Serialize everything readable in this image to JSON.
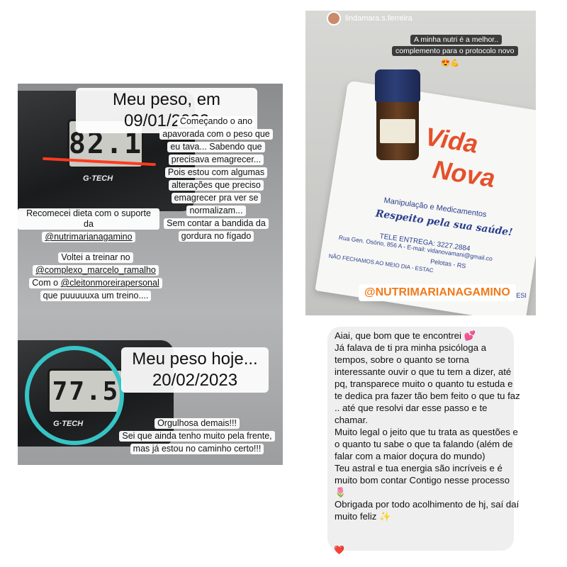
{
  "left_story": {
    "date_title": "Meu peso, em 09/01/2023",
    "scale1_reading": "82.1",
    "scale_brand": "G·TECH",
    "intro_lines": [
      "Começando o ano",
      "apavorada com o peso que",
      "eu tava... Sabendo que",
      "precisava emagrecer...",
      "Pois estou com algumas",
      "alterações que preciso",
      "emagrecer pra ver se",
      "normalizam...",
      "Sem contar a bandida da",
      "gordura no fígado"
    ],
    "diet_line": "Recomecei dieta com o suporte da",
    "diet_mention": "@nutrimarianagamino",
    "train_line1": "Voltei a treinar no",
    "train_mention1": "@complexo_marcelo_ramalho",
    "train_prefix2": "Com o",
    "train_mention2": "@cleitonmoreirapersonal",
    "train_line3": "que puuuuuxa um treino....",
    "today_title_1": "Meu peso hoje...",
    "today_title_2": "20/02/2023",
    "scale2_reading": "77.5",
    "proud_lines": [
      "Orgulhosa demais!!!",
      "Sei que ainda tenho muito pela frente,",
      "mas já estou no caminho certo!!!"
    ]
  },
  "top_right_story": {
    "username": "lindamara.s.ferreira",
    "caption_1": "A minha nutri é a melhor..",
    "caption_2": "complemento para o protocolo novo",
    "caption_emoji": "😍💪",
    "bag_brand_1": "Vida",
    "bag_brand_2": "Nova",
    "bag_subtitle": "Manipulação e Medicamentos",
    "bag_slogan": "Respeito pela sua saúde!",
    "bag_phone": "TELE ENTREGA: 3227.2884",
    "bag_address": "Rua Gen. Osório, 856 A - E-mail: vidanovamani@gmail.co",
    "bag_city": "Pelotas - RS",
    "bag_notice": "NÃO FECHAMOS AO MEIO DIA - ESTAC",
    "bag_extra": "CORTESI",
    "mention_tag": "@NUTRIMARIANAGAMINO"
  },
  "message": {
    "paragraphs": [
      "Aiai, que bom que te encontrei 💕",
      "Já falava de ti pra minha psicóloga a tempos, sobre o quanto se torna interessante ouvir o que tu tem a dizer, até pq, transparece muito o quanto tu estuda e te dedica pra fazer tão bem feito o que tu faz .. até que resolvi dar esse passo e te chamar.",
      "Muito legal o jeito que tu trata as questões e o quanto tu sabe o que ta falando (além de falar com a maior doçura do mundo)",
      "Teu astral e tua energia são incríveis e é muito bom contar Contigo nesse processo 🌷",
      "Obrigada por todo acolhimento de hj, saí daí muito feliz ✨"
    ],
    "reaction": "❤️"
  }
}
